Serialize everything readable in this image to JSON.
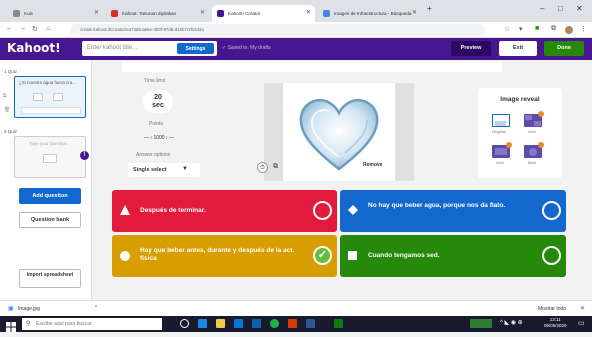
{
  "browser": {
    "tabs": [
      {
        "label": "Kuis",
        "color": "#8a8a8a"
      },
      {
        "label": "Kahoot: Tanunan dipilakan",
        "color": "#d93025"
      },
      {
        "label": "Kahoot! Creator",
        "color": "#46178f"
      },
      {
        "label": "Imagen de Infraestructura - Búsqueda",
        "color": "#4285f4"
      }
    ],
    "new_tab": "+",
    "url": "create.kahoot.it/creator/ea73d5-a66e-4b0f-97d8-d45b7c0b2d3a",
    "window_controls": [
      "–",
      "□",
      "✕"
    ]
  },
  "header": {
    "logo": "Kahoot!",
    "title_placeholder": "Enter kahoot title...",
    "settings_label": "Settings",
    "saved_label": "✓  Saved to: My drafts",
    "preview_label": "Preview",
    "exit_label": "Exit",
    "done_label": "Done",
    "colors": {
      "header": "#46178f",
      "preview": "#2a0a63",
      "done": "#26890c"
    }
  },
  "sidebar": {
    "q1_label": "1 Quiz",
    "q1_text": "¿Si nuestra agua fuera cru...",
    "q2_label": "2 Quiz",
    "q2_placeholder": "Type your question",
    "add_question": "Add question",
    "question_bank": "Question bank",
    "import_spreadsheet": "Import spreadsheet"
  },
  "settings_panel": {
    "time_limit_label": "Time limit",
    "time_value": "20",
    "time_unit": "sec",
    "points_label": "Points",
    "points_value": "1000",
    "answer_options_label": "Answer options",
    "answer_select": "Single select",
    "remove_label": "Remove"
  },
  "image_reveal": {
    "title": "Image reveal",
    "options": [
      "Original",
      "Grid",
      "Grid",
      "Blob"
    ]
  },
  "answers": [
    {
      "text": "Después de terminar.",
      "color": "#e21b3c",
      "shape": "triangle",
      "correct": false
    },
    {
      "text": "No hay que beber agua, porque nos da flato.",
      "color": "#1368ce",
      "shape": "diamond",
      "correct": false
    },
    {
      "text": "Hay que beber antes, durante y después de la act. física",
      "color": "#d89e00",
      "shape": "circle",
      "correct": true
    },
    {
      "text": "Cuando tengamos sed.",
      "color": "#26890c",
      "shape": "square",
      "correct": false
    }
  ],
  "download_bar": {
    "file": "Image.jpg",
    "show_all": "Mostrar todo"
  },
  "taskbar": {
    "search": "Escribe aquí para buscar",
    "time": "13:11",
    "date": "06/05/2020"
  }
}
